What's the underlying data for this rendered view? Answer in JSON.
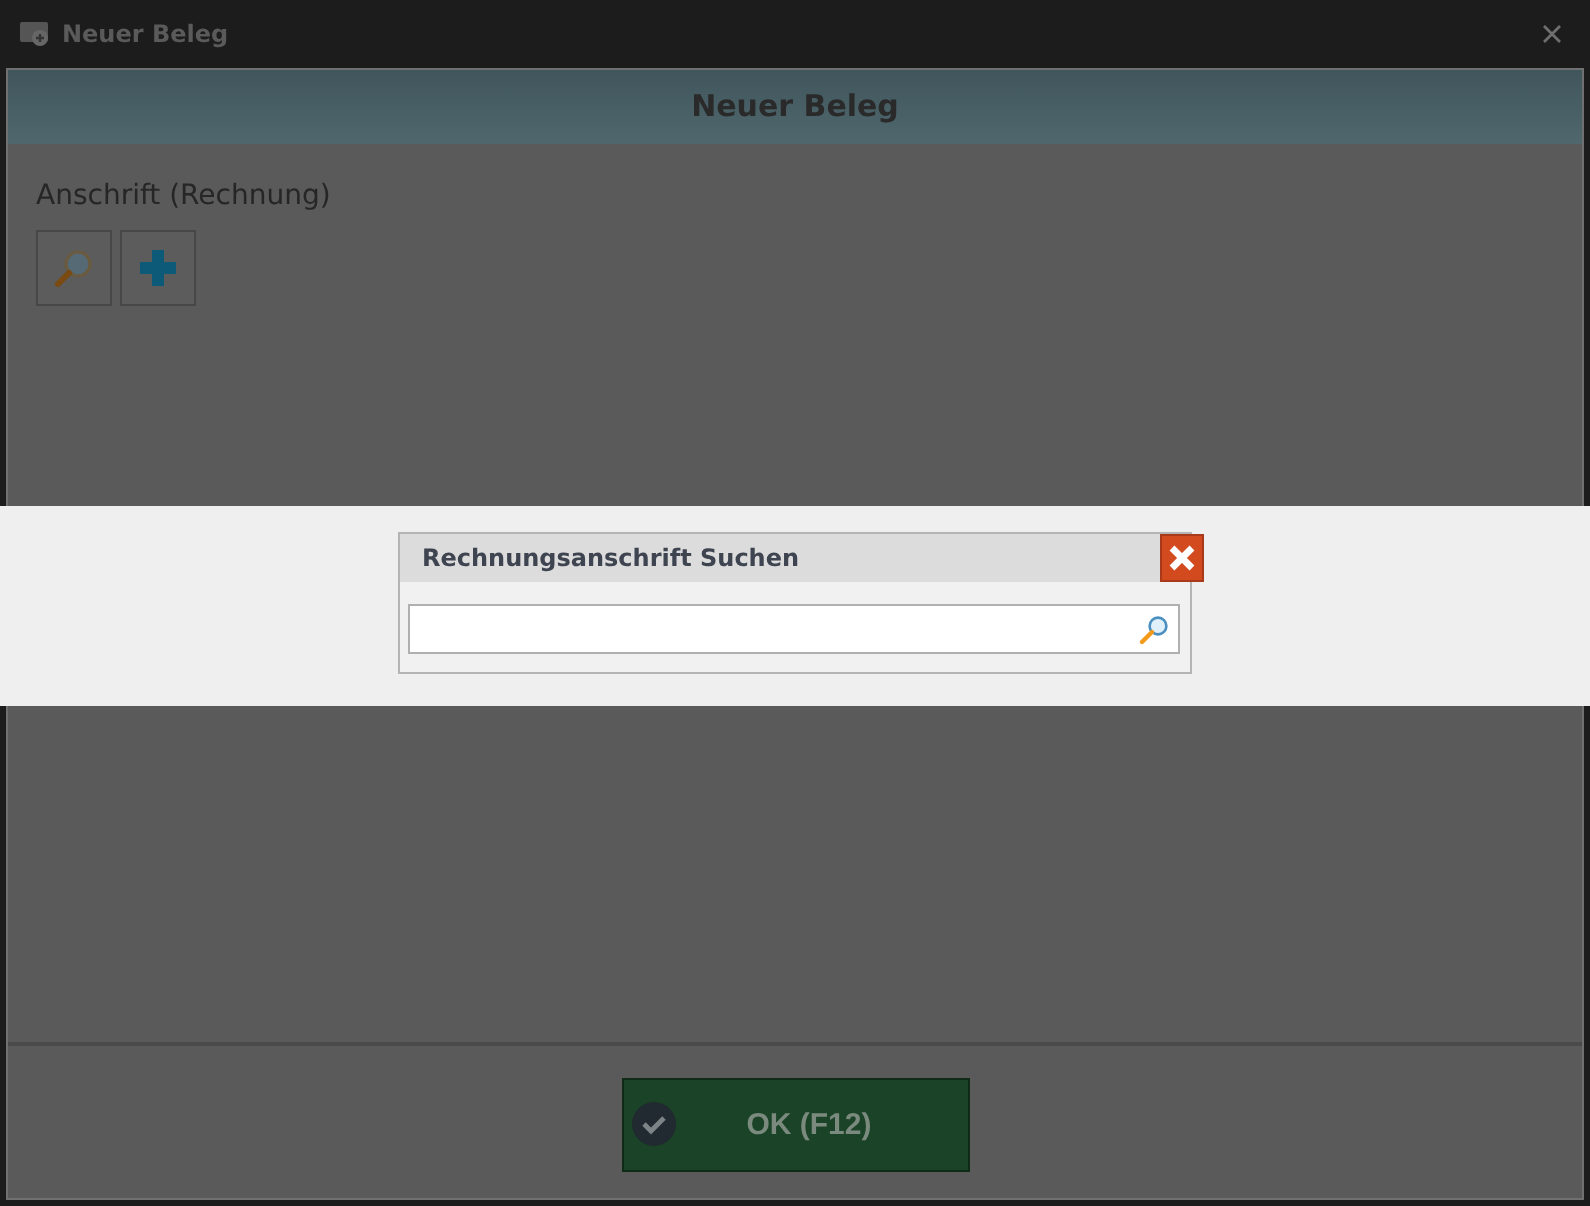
{
  "window": {
    "title": "Neuer Beleg"
  },
  "header": {
    "title": "Neuer Beleg"
  },
  "billing": {
    "label": "Anschrift (Rechnung)"
  },
  "search_dialog": {
    "title": "Rechnungsanschrift Suchen"
  },
  "footer": {
    "ok_button": "OK (F12)"
  }
}
